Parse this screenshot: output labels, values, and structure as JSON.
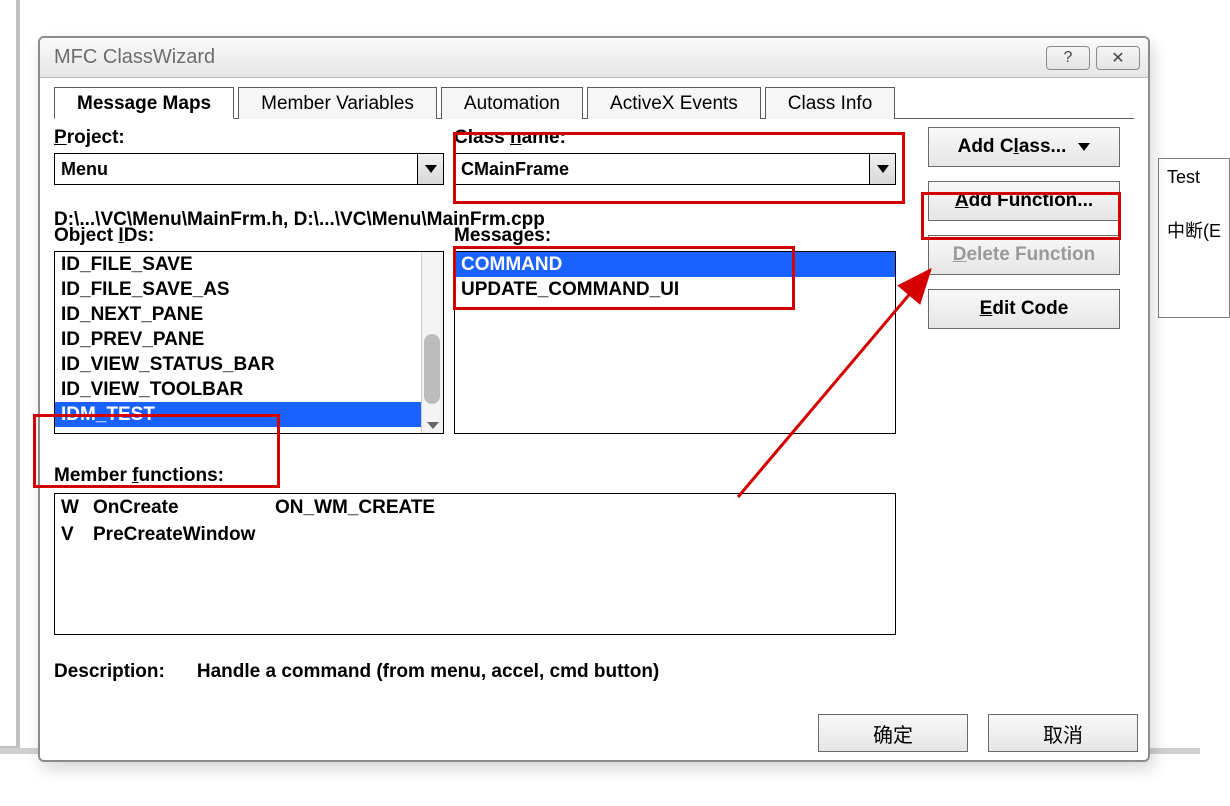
{
  "background": {
    "right_panel_line1": "Test",
    "right_panel_line2": "中断(E"
  },
  "dialog": {
    "title": "MFC ClassWizard",
    "help_symbol": "?",
    "close_symbol": "✕"
  },
  "tabs": {
    "items": [
      {
        "label": "Message Maps",
        "active": true
      },
      {
        "label": "Member Variables",
        "active": false
      },
      {
        "label": "Automation",
        "active": false
      },
      {
        "label": "ActiveX Events",
        "active": false
      },
      {
        "label": "Class Info",
        "active": false
      }
    ]
  },
  "project": {
    "label_pre": "P",
    "label_post": "roject:",
    "value": "Menu"
  },
  "class_name": {
    "label_pre": "Class ",
    "label_und": "n",
    "label_post": "ame:",
    "value": "CMainFrame"
  },
  "path_line": "D:\\...\\VC\\Menu\\MainFrm.h, D:\\...\\VC\\Menu\\MainFrm.cpp",
  "object_ids": {
    "label_pre": "Object ",
    "label_und": "I",
    "label_post": "Ds:",
    "items": [
      {
        "text": "ID_FILE_SAVE",
        "selected": false
      },
      {
        "text": "ID_FILE_SAVE_AS",
        "selected": false
      },
      {
        "text": "ID_NEXT_PANE",
        "selected": false
      },
      {
        "text": "ID_PREV_PANE",
        "selected": false
      },
      {
        "text": "ID_VIEW_STATUS_BAR",
        "selected": false
      },
      {
        "text": "ID_VIEW_TOOLBAR",
        "selected": false
      },
      {
        "text": "IDM_TEST",
        "selected": true
      }
    ]
  },
  "messages": {
    "label_pre": "Messa",
    "label_und": "g",
    "label_post": "es:",
    "items": [
      {
        "text": "COMMAND",
        "selected": true
      },
      {
        "text": "UPDATE_COMMAND_UI",
        "selected": false
      }
    ]
  },
  "member_functions": {
    "label_pre": "Member ",
    "label_und": "f",
    "label_post": "unctions:",
    "rows": [
      {
        "tag": "W",
        "fn": "OnCreate",
        "msg": "ON_WM_CREATE"
      },
      {
        "tag": "V",
        "fn": "PreCreateWindow",
        "msg": ""
      }
    ]
  },
  "description": {
    "label": "Description:",
    "value": "Handle a command (from menu, accel, cmd button)"
  },
  "buttons": {
    "add_class_pre": "Add C",
    "add_class_und": "l",
    "add_class_post": "ass...",
    "add_function_und": "A",
    "add_function_post": "dd Function...",
    "delete_function_und": "D",
    "delete_function_post": "elete Function",
    "edit_code_und": "E",
    "edit_code_post": "dit Code"
  },
  "footer": {
    "ok": "确定",
    "cancel": "取消"
  }
}
